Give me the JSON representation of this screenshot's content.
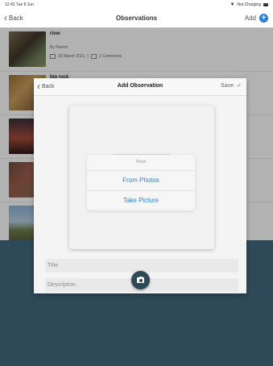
{
  "status_bar": {
    "time": "12:43  Tue 8 Jun",
    "charging": "Not Charging"
  },
  "nav": {
    "back": "Back",
    "title": "Observations",
    "add": "Add"
  },
  "list": [
    {
      "title": "river",
      "author": "By Parent",
      "date": "29 March 2021",
      "comments": "2 Comments"
    },
    {
      "title": "big rock"
    },
    {},
    {},
    {}
  ],
  "modal": {
    "back": "Back",
    "title": "Add Observation",
    "save": "Save",
    "sheet": {
      "header": "Photo",
      "from_photos": "From Photos",
      "take_picture": "Take Picture"
    },
    "title_placeholder": "Title",
    "description_placeholder": "Description"
  },
  "colors": {
    "accent": "#2f7fd4",
    "dark_panel": "#2e4a58"
  },
  "icons": {
    "add": "plus-circle-icon",
    "camera": "camera-icon",
    "save": "checkmark-icon",
    "back": "chevron-left-icon"
  }
}
